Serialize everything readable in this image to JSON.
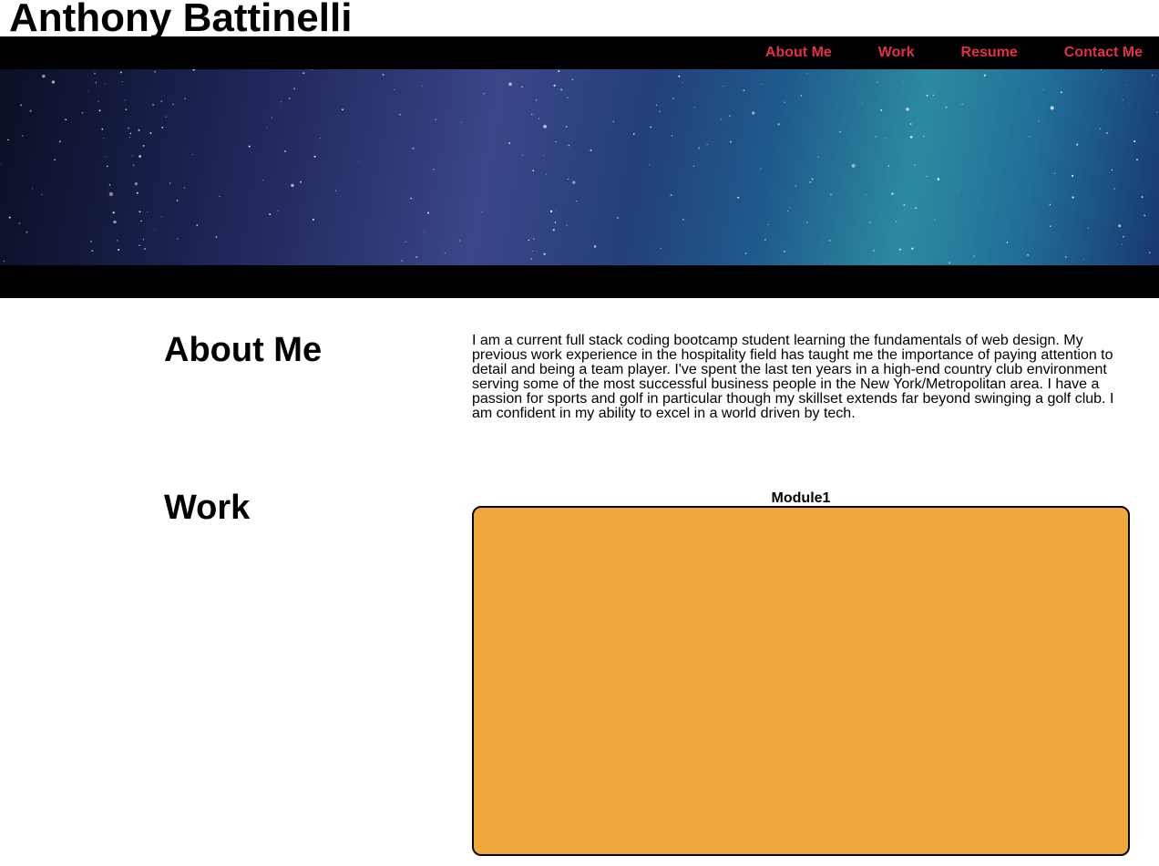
{
  "header": {
    "title": "Anthony Battinelli"
  },
  "nav": {
    "items": [
      {
        "label": "About Me"
      },
      {
        "label": "Work"
      },
      {
        "label": "Resume"
      },
      {
        "label": "Contact Me"
      }
    ],
    "link_color": "#e0304a"
  },
  "about": {
    "heading": "About Me",
    "body": "I am a current full stack coding bootcamp student learning the fundamentals of web design. My previous work experience in the hospitality field has taught me the importance of paying attention to detail and being a team player. I've spent the last ten years in a high-end country club environment serving some of the most successful business people in the New York/Metropolitan area. I have a passion for sports and golf in particular though my skillset extends far beyond swinging a golf club. I am confident in my ability to excel in a world driven by tech."
  },
  "work": {
    "heading": "Work",
    "modules": [
      {
        "label": "Module1",
        "color": "#f0a83c"
      }
    ]
  }
}
